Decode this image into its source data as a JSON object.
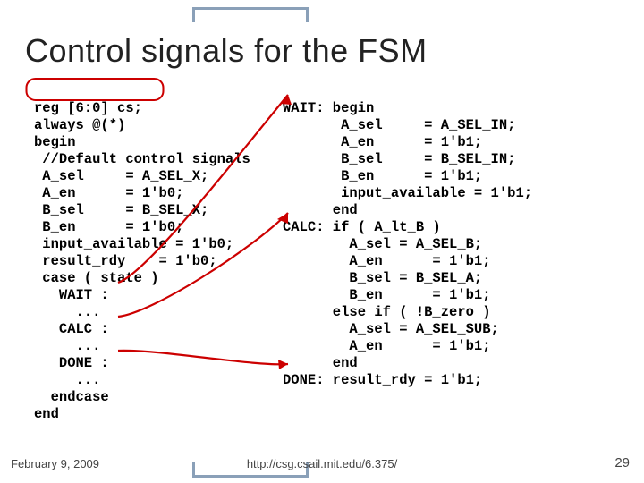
{
  "title": "Control signals for the FSM",
  "code_left": "reg [6:0] cs;\nalways @(*)\nbegin\n //Default control signals\n A_sel     = A_SEL_X;\n A_en      = 1'b0;\n B_sel     = B_SEL_X;\n B_en      = 1'b0;\n input_available = 1'b0;\n result_rdy    = 1'b0;\n case ( state )\n   WAIT :\n     ...\n   CALC :\n     ...\n   DONE :\n     ...\n  endcase\nend",
  "code_right": "WAIT: begin\n       A_sel     = A_SEL_IN;\n       A_en      = 1'b1;\n       B_sel     = B_SEL_IN;\n       B_en      = 1'b1;\n       input_available = 1'b1;\n      end\nCALC: if ( A_lt_B )\n        A_sel = A_SEL_B;\n        A_en      = 1'b1;\n        B_sel = B_SEL_A;\n        B_en      = 1'b1;\n      else if ( !B_zero )\n        A_sel = A_SEL_SUB;\n        A_en      = 1'b1;\n      end\nDONE: result_rdy = 1'b1;",
  "footer": {
    "left": "February 9, 2009",
    "center": "http://csg.csail.mit.edu/6.375/",
    "right": "29"
  }
}
